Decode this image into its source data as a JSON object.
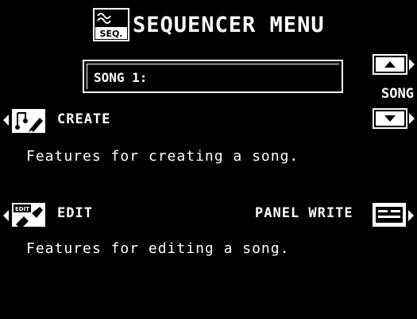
{
  "header": {
    "title": "SEQUENCER MENU",
    "icon": "seq-icon",
    "icon_badge": "SEQ."
  },
  "song_select": {
    "value": "SONG 1:",
    "label": "SONG",
    "up_icon": "arrow-up-icon",
    "down_icon": "arrow-down-icon"
  },
  "create": {
    "label": "CREATE",
    "description": "Features for creating a song.",
    "icon": "create-icon"
  },
  "edit": {
    "label": "EDIT",
    "description": "Features for editing a song.",
    "icon": "edit-icon",
    "icon_badge": "EDIT"
  },
  "panel_write": {
    "label": "PANEL WRITE",
    "icon": "panel-write-icon"
  },
  "colors": {
    "background": "#000000",
    "foreground": "#ffffff"
  }
}
